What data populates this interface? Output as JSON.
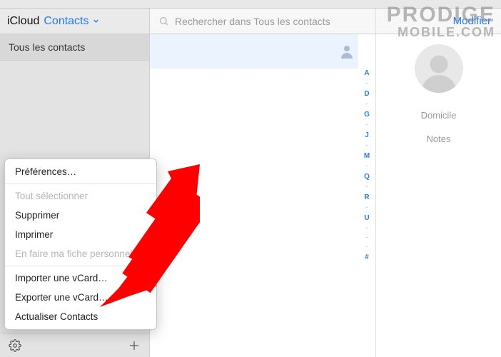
{
  "header": {
    "brand": "iCloud",
    "app": "Contacts",
    "search_placeholder": "Rechercher dans Tous les contacts",
    "modify": "Modifier"
  },
  "sidebar": {
    "group_all": "Tous les contacts"
  },
  "alpha_index": [
    "A",
    "·",
    "D",
    "·",
    "G",
    "·",
    "J",
    "·",
    "M",
    "·",
    "Q",
    "·",
    "R",
    "·",
    "U",
    "·",
    "·",
    "·",
    "#"
  ],
  "detail": {
    "home": "Domicile",
    "notes": "Notes"
  },
  "menu": {
    "preferences": "Préférences…",
    "select_all": "Tout sélectionner",
    "delete": "Supprimer",
    "print": "Imprimer",
    "make_my_card": "En faire ma fiche personnelle",
    "import_vcard": "Importer une vCard…",
    "export_vcard": "Exporter une vCard…",
    "refresh": "Actualiser Contacts"
  },
  "watermark": {
    "line1": "PRODIGE",
    "line2": "MOBILE.COM"
  }
}
